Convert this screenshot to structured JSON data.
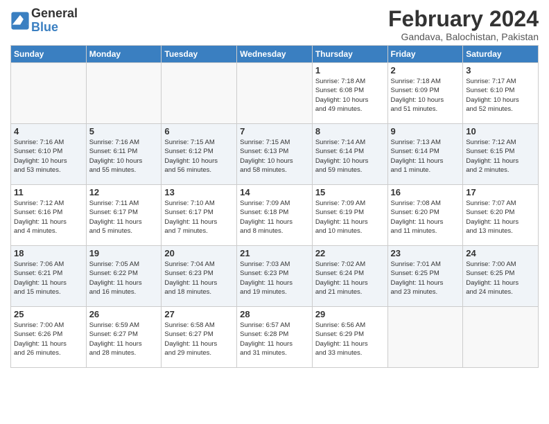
{
  "header": {
    "logo_general": "General",
    "logo_blue": "Blue",
    "month_title": "February 2024",
    "subtitle": "Gandava, Balochistan, Pakistan"
  },
  "days_of_week": [
    "Sunday",
    "Monday",
    "Tuesday",
    "Wednesday",
    "Thursday",
    "Friday",
    "Saturday"
  ],
  "weeks": [
    [
      {
        "day": "",
        "info": ""
      },
      {
        "day": "",
        "info": ""
      },
      {
        "day": "",
        "info": ""
      },
      {
        "day": "",
        "info": ""
      },
      {
        "day": "1",
        "info": "Sunrise: 7:18 AM\nSunset: 6:08 PM\nDaylight: 10 hours\nand 49 minutes."
      },
      {
        "day": "2",
        "info": "Sunrise: 7:18 AM\nSunset: 6:09 PM\nDaylight: 10 hours\nand 51 minutes."
      },
      {
        "day": "3",
        "info": "Sunrise: 7:17 AM\nSunset: 6:10 PM\nDaylight: 10 hours\nand 52 minutes."
      }
    ],
    [
      {
        "day": "4",
        "info": "Sunrise: 7:16 AM\nSunset: 6:10 PM\nDaylight: 10 hours\nand 53 minutes."
      },
      {
        "day": "5",
        "info": "Sunrise: 7:16 AM\nSunset: 6:11 PM\nDaylight: 10 hours\nand 55 minutes."
      },
      {
        "day": "6",
        "info": "Sunrise: 7:15 AM\nSunset: 6:12 PM\nDaylight: 10 hours\nand 56 minutes."
      },
      {
        "day": "7",
        "info": "Sunrise: 7:15 AM\nSunset: 6:13 PM\nDaylight: 10 hours\nand 58 minutes."
      },
      {
        "day": "8",
        "info": "Sunrise: 7:14 AM\nSunset: 6:14 PM\nDaylight: 10 hours\nand 59 minutes."
      },
      {
        "day": "9",
        "info": "Sunrise: 7:13 AM\nSunset: 6:14 PM\nDaylight: 11 hours\nand 1 minute."
      },
      {
        "day": "10",
        "info": "Sunrise: 7:12 AM\nSunset: 6:15 PM\nDaylight: 11 hours\nand 2 minutes."
      }
    ],
    [
      {
        "day": "11",
        "info": "Sunrise: 7:12 AM\nSunset: 6:16 PM\nDaylight: 11 hours\nand 4 minutes."
      },
      {
        "day": "12",
        "info": "Sunrise: 7:11 AM\nSunset: 6:17 PM\nDaylight: 11 hours\nand 5 minutes."
      },
      {
        "day": "13",
        "info": "Sunrise: 7:10 AM\nSunset: 6:17 PM\nDaylight: 11 hours\nand 7 minutes."
      },
      {
        "day": "14",
        "info": "Sunrise: 7:09 AM\nSunset: 6:18 PM\nDaylight: 11 hours\nand 8 minutes."
      },
      {
        "day": "15",
        "info": "Sunrise: 7:09 AM\nSunset: 6:19 PM\nDaylight: 11 hours\nand 10 minutes."
      },
      {
        "day": "16",
        "info": "Sunrise: 7:08 AM\nSunset: 6:20 PM\nDaylight: 11 hours\nand 11 minutes."
      },
      {
        "day": "17",
        "info": "Sunrise: 7:07 AM\nSunset: 6:20 PM\nDaylight: 11 hours\nand 13 minutes."
      }
    ],
    [
      {
        "day": "18",
        "info": "Sunrise: 7:06 AM\nSunset: 6:21 PM\nDaylight: 11 hours\nand 15 minutes."
      },
      {
        "day": "19",
        "info": "Sunrise: 7:05 AM\nSunset: 6:22 PM\nDaylight: 11 hours\nand 16 minutes."
      },
      {
        "day": "20",
        "info": "Sunrise: 7:04 AM\nSunset: 6:23 PM\nDaylight: 11 hours\nand 18 minutes."
      },
      {
        "day": "21",
        "info": "Sunrise: 7:03 AM\nSunset: 6:23 PM\nDaylight: 11 hours\nand 19 minutes."
      },
      {
        "day": "22",
        "info": "Sunrise: 7:02 AM\nSunset: 6:24 PM\nDaylight: 11 hours\nand 21 minutes."
      },
      {
        "day": "23",
        "info": "Sunrise: 7:01 AM\nSunset: 6:25 PM\nDaylight: 11 hours\nand 23 minutes."
      },
      {
        "day": "24",
        "info": "Sunrise: 7:00 AM\nSunset: 6:25 PM\nDaylight: 11 hours\nand 24 minutes."
      }
    ],
    [
      {
        "day": "25",
        "info": "Sunrise: 7:00 AM\nSunset: 6:26 PM\nDaylight: 11 hours\nand 26 minutes."
      },
      {
        "day": "26",
        "info": "Sunrise: 6:59 AM\nSunset: 6:27 PM\nDaylight: 11 hours\nand 28 minutes."
      },
      {
        "day": "27",
        "info": "Sunrise: 6:58 AM\nSunset: 6:27 PM\nDaylight: 11 hours\nand 29 minutes."
      },
      {
        "day": "28",
        "info": "Sunrise: 6:57 AM\nSunset: 6:28 PM\nDaylight: 11 hours\nand 31 minutes."
      },
      {
        "day": "29",
        "info": "Sunrise: 6:56 AM\nSunset: 6:29 PM\nDaylight: 11 hours\nand 33 minutes."
      },
      {
        "day": "",
        "info": ""
      },
      {
        "day": "",
        "info": ""
      }
    ]
  ]
}
